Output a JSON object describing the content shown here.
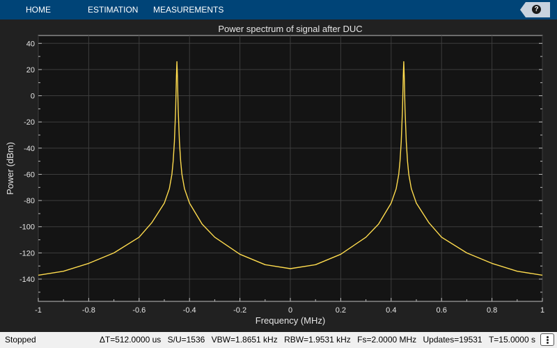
{
  "toolstrip": {
    "tabs": [
      "HOME",
      "ESTIMATION",
      "MEASUREMENTS"
    ],
    "help_label": "?"
  },
  "status": {
    "state": "Stopped",
    "items": [
      "ΔT=512.0000 us",
      "S/U=1536",
      "VBW=1.8651 kHz",
      "RBW=1.9531 kHz",
      "Fs=2.0000 MHz",
      "Updates=19531",
      "T=15.0000 s"
    ]
  },
  "colors": {
    "toolstrip": "#004477",
    "plot_bg": "#141414",
    "figure_bg": "#212121",
    "grid": "#3d3d3d",
    "trace": "#ffdc4e",
    "text": "#e6e6e6"
  },
  "chart_data": {
    "type": "line",
    "title": "Power spectrum of signal after DUC",
    "xlabel": "Frequency (MHz)",
    "ylabel": "Power (dBm)",
    "xlim": [
      -1,
      1
    ],
    "ylim": [
      -157,
      46
    ],
    "xticks": [
      -1,
      -0.8,
      -0.6,
      -0.4,
      -0.2,
      0,
      0.2,
      0.4,
      0.6,
      0.8,
      1
    ],
    "xtick_labels": [
      "-1",
      "-0.8",
      "-0.6",
      "-0.4",
      "-0.2",
      "0",
      "0.2",
      "0.4",
      "0.6",
      "0.8",
      "1"
    ],
    "yticks": [
      40,
      20,
      0,
      -20,
      -40,
      -60,
      -80,
      -100,
      -120,
      -140
    ],
    "ytick_labels": [
      "40",
      "20",
      "0",
      "-20",
      "-40",
      "-60",
      "-80",
      "-100",
      "-120",
      "-140"
    ],
    "grid": true,
    "series": [
      {
        "x": [
          -1,
          -0.9,
          -0.8,
          -0.7,
          -0.6,
          -0.55,
          -0.5,
          -0.48,
          -0.47,
          -0.465,
          -0.46,
          -0.455,
          -0.452,
          -0.45,
          -0.448,
          -0.445,
          -0.44,
          -0.435,
          -0.43,
          -0.42,
          -0.4,
          -0.35,
          -0.3,
          -0.2,
          -0.1,
          0,
          0.1,
          0.2,
          0.3,
          0.35,
          0.4,
          0.42,
          0.43,
          0.435,
          0.44,
          0.445,
          0.448,
          0.45,
          0.452,
          0.455,
          0.46,
          0.465,
          0.47,
          0.48,
          0.5,
          0.55,
          0.6,
          0.7,
          0.8,
          0.9,
          1
        ],
        "y": [
          -137,
          -134,
          -128,
          -120,
          -108,
          -97,
          -82,
          -71,
          -60,
          -50,
          -35,
          -10,
          15,
          26,
          15,
          -10,
          -35,
          -50,
          -60,
          -71,
          -82,
          -98,
          -108,
          -121,
          -129,
          -132,
          -129,
          -121,
          -108,
          -98,
          -82,
          -71,
          -60,
          -50,
          -35,
          -10,
          15,
          26,
          15,
          -10,
          -35,
          -50,
          -60,
          -71,
          -82,
          -97,
          -108,
          -120,
          -128,
          -134,
          -137
        ]
      }
    ]
  }
}
